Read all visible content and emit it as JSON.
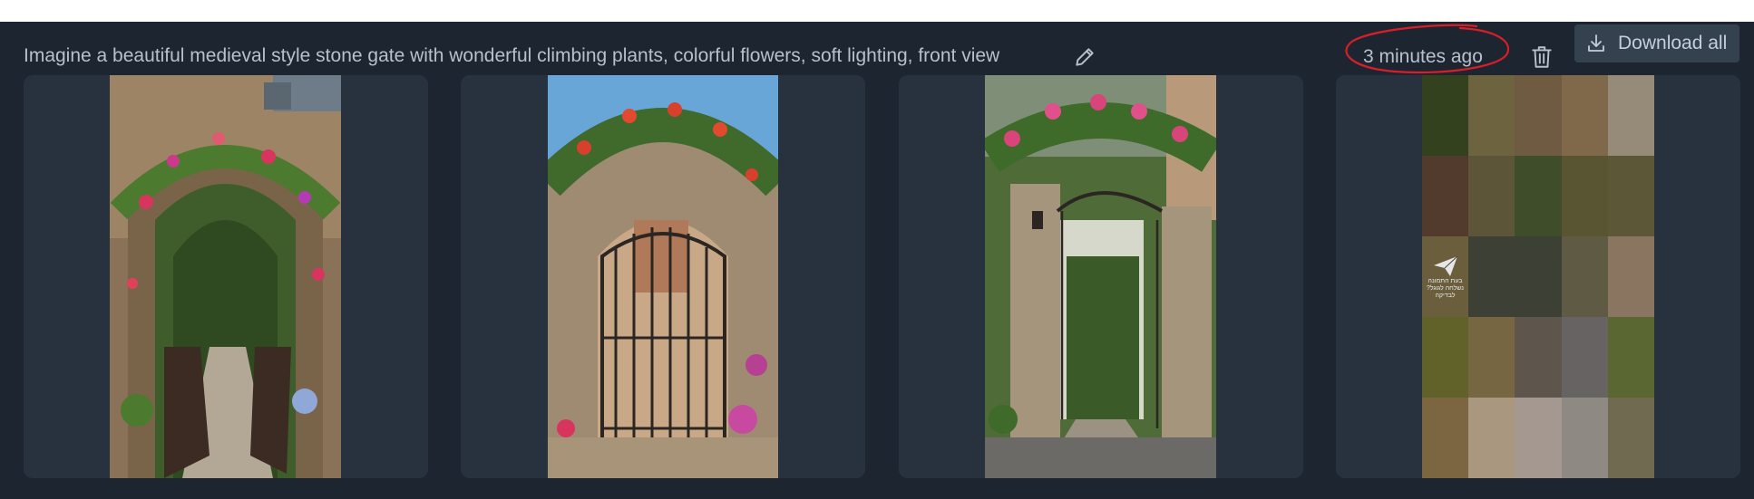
{
  "header": {
    "prompt": "Imagine a beautiful medieval style stone gate with wonderful climbing plants, colorful flowers, soft lighting, front view",
    "time_ago": "3 minutes ago",
    "download_label": "Download all",
    "icons": [
      "pencil-icon",
      "trash-icon",
      "download-icon"
    ]
  },
  "images": [
    {
      "type": "photo",
      "subject": "stone arch with open iron gate and flowers"
    },
    {
      "type": "photo",
      "subject": "stone arch with closed iron gate"
    },
    {
      "type": "photo",
      "subject": "stone pillars with iron arch gate"
    },
    {
      "type": "blurred-mosaic",
      "badge_lines": [
        "בעת התמונה",
        "נשלחה לגוגל?",
        "לבדיקה"
      ],
      "mosaic_colors": [
        "#33411f",
        "#6e633f",
        "#6f5b42",
        "#80694a",
        "#958b78",
        "#523b2d",
        "#5d5537",
        "#404d2b",
        "#595533",
        "#5b5737",
        "#6a5e3d",
        "#796a4b",
        "#3d4035",
        "#5e5a44",
        "#8a7560",
        "#606229",
        "#776642",
        "#5e564c",
        "#676363",
        "#5a6733",
        "#7c6541",
        "#a99780",
        "#a49891",
        "#8f8984",
        "#6f6a50"
      ]
    }
  ],
  "colors": {
    "background": "#1d2630",
    "card": "#27323e",
    "button": "#34424f",
    "text": "#b7c0cb",
    "annotation": "#d81e28"
  }
}
